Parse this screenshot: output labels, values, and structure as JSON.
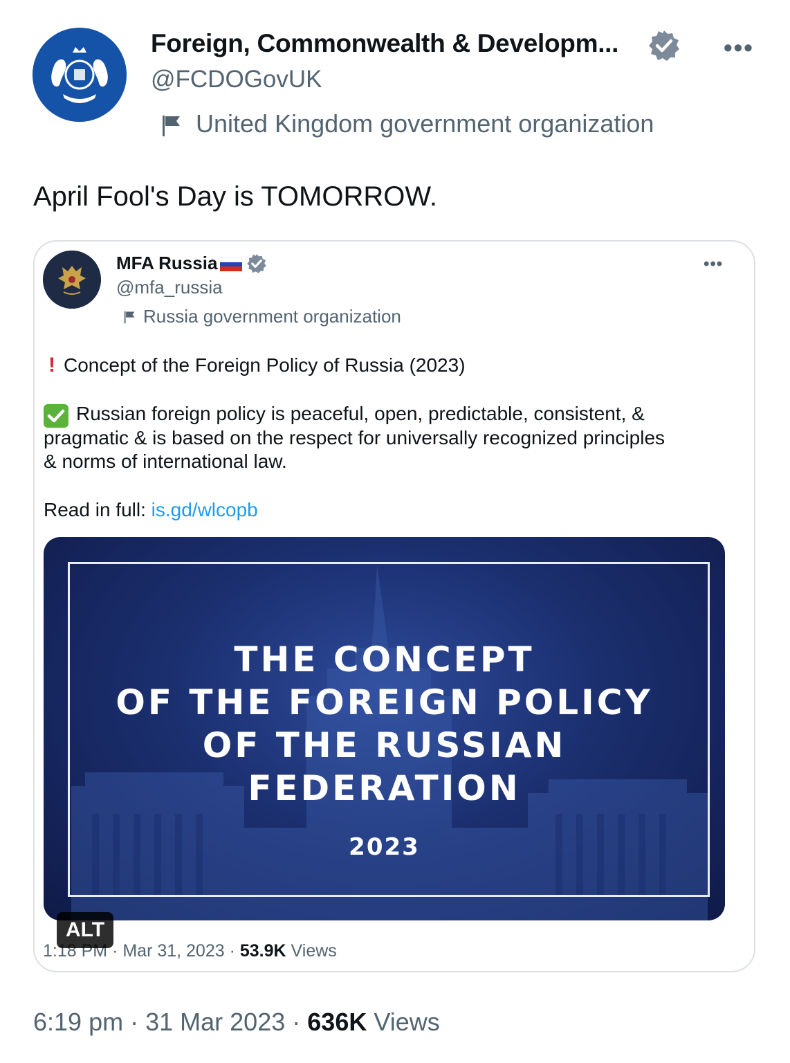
{
  "tweet": {
    "author_name": "Foreign, Commonwealth & Developm...",
    "handle": "@FCDOGovUK",
    "label": "United Kingdom government organization",
    "more": "•••",
    "text": "April Fool's Day is TOMORROW.",
    "time": "6:19 pm",
    "date": "31 Mar 2023",
    "sep": "·",
    "views_count": "636K",
    "views_label": "Views"
  },
  "quoted": {
    "author_name": "MFA Russia",
    "handle": "@mfa_russia",
    "label": "Russia government organization",
    "more": "•••",
    "line1": "Concept of the Foreign Policy of Russia (2023)",
    "excl": "!",
    "line2": "Russian foreign policy is peaceful, open, predictable, consistent, &",
    "line3": "pragmatic & is based on the respect for universally recognized principles",
    "line4": "& norms of international law.",
    "read_prefix": "Read in full: ",
    "read_link": "is.gd/wlcopb",
    "image": {
      "title_lines": [
        "THE CONCEPT",
        "OF THE FOREIGN POLICY",
        "OF THE RUSSIAN",
        "FEDERATION"
      ],
      "year": "2023"
    },
    "alt_badge": "ALT",
    "time": "1:18 PM",
    "date": "· Mar 31, 2023 ·",
    "views_count": "53.9K",
    "views_label": "Views"
  },
  "colors": {
    "link": "#1d9bf0",
    "verified_badge": "#7c8a99",
    "fcdo_avatar": "#1553a8",
    "image_background": "#1b2f6f"
  },
  "icons": [
    "verified-badge-icon",
    "flag-icon",
    "more-options-icon",
    "exclamation-icon",
    "check-mark-icon",
    "russian-flag-icon"
  ]
}
